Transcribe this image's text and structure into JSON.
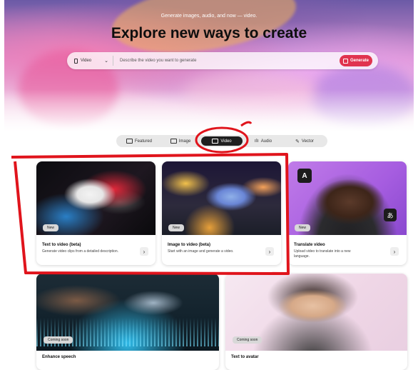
{
  "hero": {
    "subtitle": "Generate images, audio, and now — video.",
    "title": "Explore new ways to create"
  },
  "prompt": {
    "mode_label": "Video",
    "placeholder": "Describe the video you want to generate",
    "generate_label": "Generate"
  },
  "tabs": [
    {
      "label": "Featured",
      "active": false
    },
    {
      "label": "Image",
      "active": false
    },
    {
      "label": "Video",
      "active": true
    },
    {
      "label": "Audio",
      "active": false
    },
    {
      "label": "Vector",
      "active": false
    }
  ],
  "cards": [
    {
      "badge": "New",
      "title": "Text to video (beta)",
      "description": "Generate video clips from a detailed description."
    },
    {
      "badge": "New",
      "title": "Image to video (beta)",
      "description": "Start with an image and generate a video."
    },
    {
      "badge": "New",
      "title": "Translate video",
      "description": "Upload video to translate into a new language."
    },
    {
      "badge": "Coming soon",
      "title": "Enhance speech",
      "description": ""
    },
    {
      "badge": "Coming soon",
      "title": "Text to avatar",
      "description": ""
    }
  ],
  "avatar_glyphs": {
    "latin": "A",
    "japanese": "あ"
  },
  "annotation_color": "#e0141c"
}
